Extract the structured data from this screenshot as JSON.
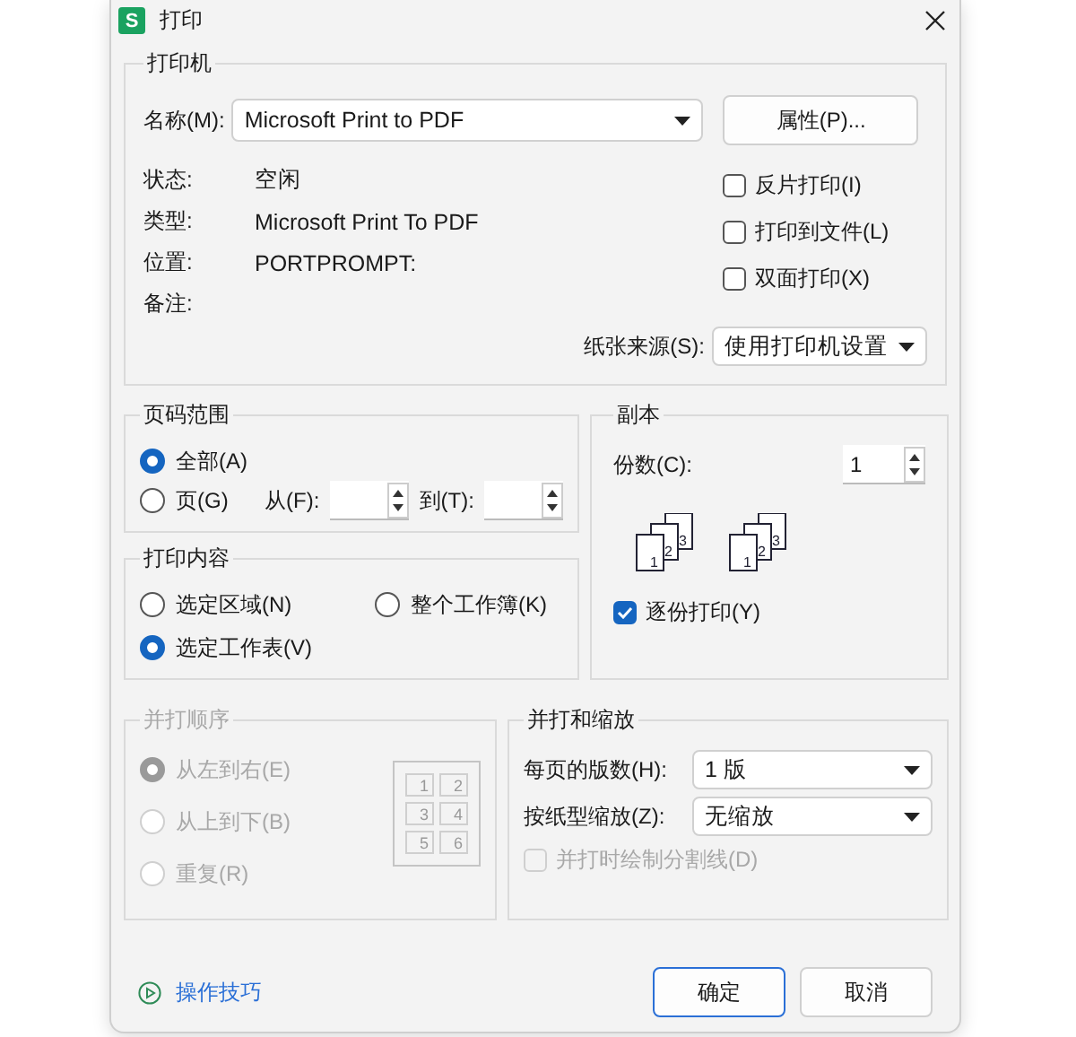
{
  "window": {
    "title": "打印",
    "app_badge": "S"
  },
  "printer": {
    "legend": "打印机",
    "name_label": "名称(M):",
    "name_value": "Microsoft Print to PDF",
    "properties_button": "属性(P)...",
    "info": [
      {
        "label": "状态:",
        "value": "空闲"
      },
      {
        "label": "类型:",
        "value": "Microsoft Print To PDF"
      },
      {
        "label": "位置:",
        "value": "PORTPROMPT:"
      },
      {
        "label": "备注:"
      }
    ],
    "options": [
      {
        "label": "反片打印(I)",
        "checked": false
      },
      {
        "label": "打印到文件(L)",
        "checked": false
      },
      {
        "label": "双面打印(X)",
        "checked": false
      }
    ],
    "paper_source_label": "纸张来源(S):",
    "paper_source_value": "使用打印机设置"
  },
  "page_range": {
    "legend": "页码范围",
    "options": [
      {
        "label": "全部(A)",
        "selected": true
      },
      {
        "label": "页(G)",
        "selected": false
      }
    ],
    "from_label": "从(F):",
    "to_label": "到(T):"
  },
  "copies": {
    "legend": "副本",
    "count_label": "份数(C):",
    "count_value": "1",
    "collate_icons": [
      [
        "1",
        "2",
        "3"
      ],
      [
        "1",
        "2",
        "3"
      ]
    ],
    "collate": {
      "label": "逐份打印(Y)",
      "checked": true
    }
  },
  "print_content": {
    "legend": "打印内容",
    "options": [
      {
        "label": "选定区域(N)",
        "selected": false
      },
      {
        "label": "整个工作簿(K)",
        "selected": false
      },
      {
        "label": "选定工作表(V)",
        "selected": true
      }
    ]
  },
  "order": {
    "legend": "并打顺序",
    "disabled": true,
    "options": [
      {
        "label": "从左到右(E)",
        "selected": true
      },
      {
        "label": "从上到下(B)",
        "selected": false
      },
      {
        "label": "重复(R)",
        "selected": false
      }
    ],
    "grid": [
      "1",
      "2",
      "3",
      "4",
      "5",
      "6"
    ]
  },
  "scaling": {
    "legend": "并打和缩放",
    "pages_per_sheet_label": "每页的版数(H):",
    "pages_per_sheet_value": "1 版",
    "scale_label": "按纸型缩放(Z):",
    "scale_value": "无缩放",
    "divider": {
      "label": "并打时绘制分割线(D)",
      "checked": false,
      "disabled": true
    }
  },
  "footer": {
    "tips_link": "操作技巧",
    "buttons": [
      {
        "label": "确定",
        "default": true
      },
      {
        "label": "取消",
        "default": false
      }
    ]
  }
}
